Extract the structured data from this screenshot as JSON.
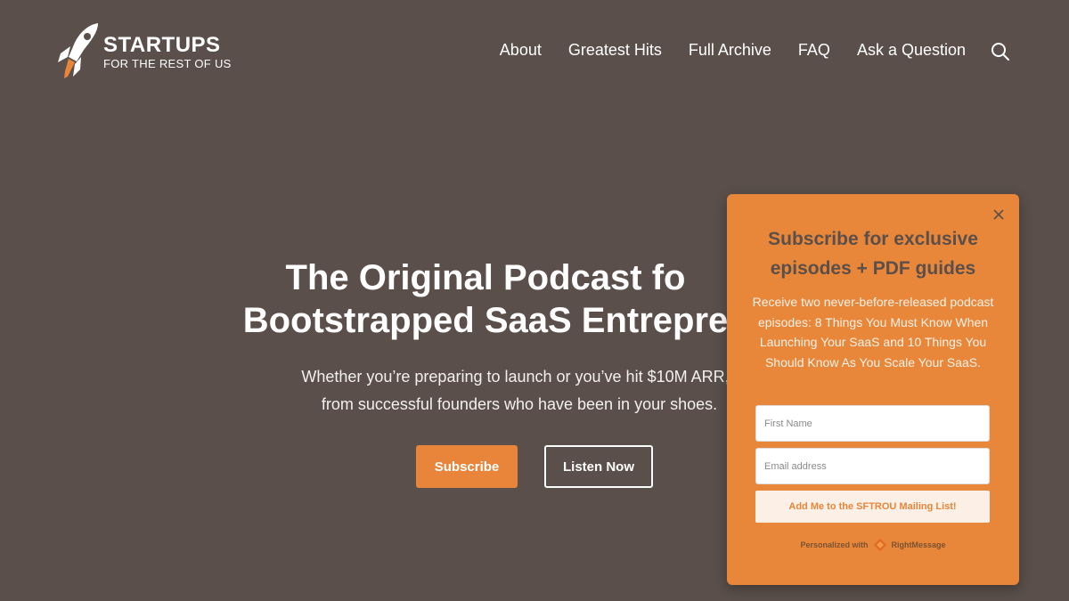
{
  "header": {
    "logo_title": "STARTUPS",
    "logo_subtitle": "FOR THE REST OF US",
    "nav": [
      {
        "label": "About"
      },
      {
        "label": "Greatest Hits"
      },
      {
        "label": "Full Archive"
      },
      {
        "label": "FAQ"
      },
      {
        "label": "Ask a Question"
      }
    ],
    "search_icon": "search-icon"
  },
  "hero": {
    "title_line1": "The Original Podcast fo",
    "title_line2": "Bootstrapped SaaS Entrepre",
    "subtitle_line1": "Whether you’re preparing to launch or you’ve hit $10M ARR, l",
    "subtitle_line2": "from successful founders who have been in your shoes.",
    "subscribe_label": "Subscribe",
    "listen_label": "Listen Now"
  },
  "popup": {
    "title_line1": "Subscribe for exclusive",
    "title_line2": "episodes + PDF guides",
    "description": "Receive two never-before-released podcast episodes: 8 Things You Must Know When Launching Your SaaS and 10 Things You Should Know As You Scale Your SaaS.",
    "first_name_placeholder": "First Name",
    "email_placeholder": "Email address",
    "submit_label": "Add Me to the SFTROU Mailing List!",
    "powered_prefix": "Personalized with",
    "powered_brand": "RightMessage"
  },
  "colors": {
    "background": "#5a4f4a",
    "accent": "#e8853a",
    "popup_bg": "#e8873a"
  }
}
